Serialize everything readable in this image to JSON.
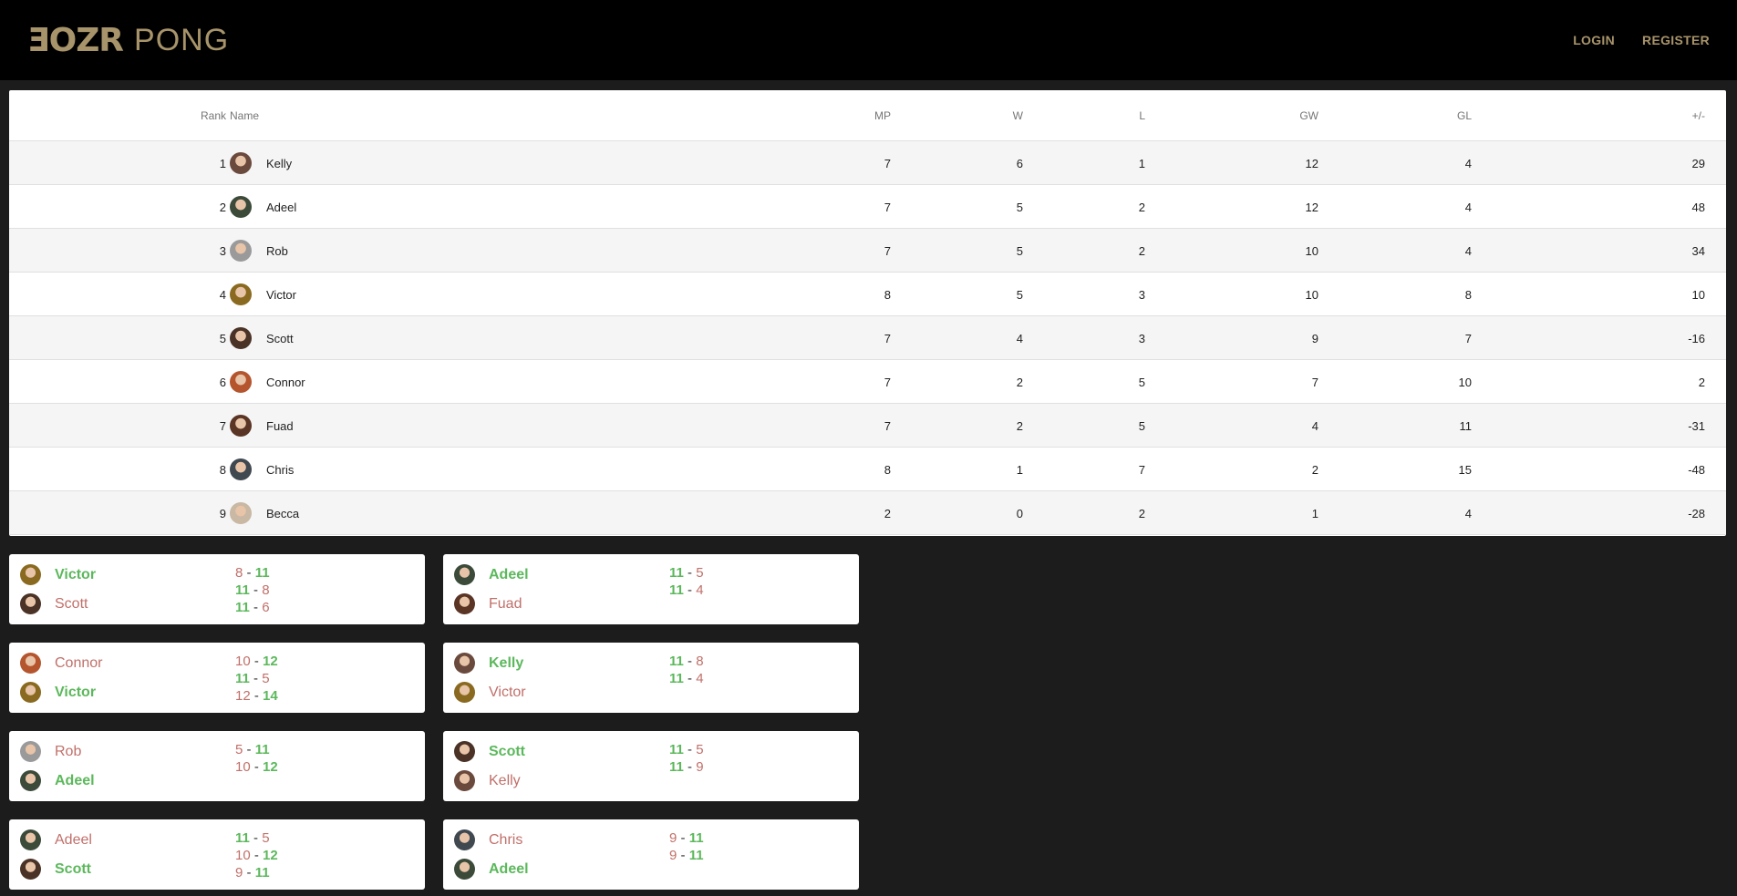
{
  "brand": {
    "mark": "ƎOZR",
    "word": "PONG",
    "color": "#a8946a"
  },
  "nav": {
    "login": "LOGIN",
    "register": "REGISTER"
  },
  "table": {
    "headers": {
      "rank": "Rank",
      "name": "Name",
      "mp": "MP",
      "w": "W",
      "l": "L",
      "gw": "GW",
      "gl": "GL",
      "pm": "+/-"
    },
    "rows": [
      {
        "rank": "1",
        "name": "Kelly",
        "mp": "7",
        "w": "6",
        "l": "1",
        "gw": "12",
        "gl": "4",
        "pm": "29"
      },
      {
        "rank": "2",
        "name": "Adeel",
        "mp": "7",
        "w": "5",
        "l": "2",
        "gw": "12",
        "gl": "4",
        "pm": "48"
      },
      {
        "rank": "3",
        "name": "Rob",
        "mp": "7",
        "w": "5",
        "l": "2",
        "gw": "10",
        "gl": "4",
        "pm": "34"
      },
      {
        "rank": "4",
        "name": "Victor",
        "mp": "8",
        "w": "5",
        "l": "3",
        "gw": "10",
        "gl": "8",
        "pm": "10"
      },
      {
        "rank": "5",
        "name": "Scott",
        "mp": "7",
        "w": "4",
        "l": "3",
        "gw": "9",
        "gl": "7",
        "pm": "-16"
      },
      {
        "rank": "6",
        "name": "Connor",
        "mp": "7",
        "w": "2",
        "l": "5",
        "gw": "7",
        "gl": "10",
        "pm": "2"
      },
      {
        "rank": "7",
        "name": "Fuad",
        "mp": "7",
        "w": "2",
        "l": "5",
        "gw": "4",
        "gl": "11",
        "pm": "-31"
      },
      {
        "rank": "8",
        "name": "Chris",
        "mp": "8",
        "w": "1",
        "l": "7",
        "gw": "2",
        "gl": "15",
        "pm": "-48"
      },
      {
        "rank": "9",
        "name": "Becca",
        "mp": "2",
        "w": "0",
        "l": "2",
        "gw": "1",
        "gl": "4",
        "pm": "-28"
      }
    ]
  },
  "matches": [
    {
      "p1": {
        "name": "Victor",
        "win": true
      },
      "p2": {
        "name": "Scott",
        "win": false
      },
      "sets": [
        {
          "a": "8",
          "b": "11",
          "aw": false
        },
        {
          "a": "11",
          "b": "8",
          "aw": true
        },
        {
          "a": "11",
          "b": "6",
          "aw": true
        }
      ]
    },
    {
      "p1": {
        "name": "Adeel",
        "win": true
      },
      "p2": {
        "name": "Fuad",
        "win": false
      },
      "sets": [
        {
          "a": "11",
          "b": "5",
          "aw": true
        },
        {
          "a": "11",
          "b": "4",
          "aw": true
        }
      ]
    },
    {
      "p1": {
        "name": "Connor",
        "win": false
      },
      "p2": {
        "name": "Victor",
        "win": true
      },
      "sets": [
        {
          "a": "10",
          "b": "12",
          "aw": false
        },
        {
          "a": "11",
          "b": "5",
          "aw": true
        },
        {
          "a": "12",
          "b": "14",
          "aw": false
        }
      ]
    },
    {
      "p1": {
        "name": "Kelly",
        "win": true
      },
      "p2": {
        "name": "Victor",
        "win": false
      },
      "sets": [
        {
          "a": "11",
          "b": "8",
          "aw": true
        },
        {
          "a": "11",
          "b": "4",
          "aw": true
        }
      ]
    },
    {
      "p1": {
        "name": "Rob",
        "win": false
      },
      "p2": {
        "name": "Adeel",
        "win": true
      },
      "sets": [
        {
          "a": "5",
          "b": "11",
          "aw": false
        },
        {
          "a": "10",
          "b": "12",
          "aw": false
        }
      ]
    },
    {
      "p1": {
        "name": "Scott",
        "win": true
      },
      "p2": {
        "name": "Kelly",
        "win": false
      },
      "sets": [
        {
          "a": "11",
          "b": "5",
          "aw": true
        },
        {
          "a": "11",
          "b": "9",
          "aw": true
        }
      ]
    },
    {
      "p1": {
        "name": "Adeel",
        "win": false
      },
      "p2": {
        "name": "Scott",
        "win": true
      },
      "sets": [
        {
          "a": "11",
          "b": "5",
          "aw": true
        },
        {
          "a": "10",
          "b": "12",
          "aw": false
        },
        {
          "a": "9",
          "b": "11",
          "aw": false
        }
      ]
    },
    {
      "p1": {
        "name": "Chris",
        "win": false
      },
      "p2": {
        "name": "Adeel",
        "win": true
      },
      "sets": [
        {
          "a": "9",
          "b": "11",
          "aw": false
        },
        {
          "a": "9",
          "b": "11",
          "aw": false
        }
      ]
    }
  ],
  "avatar_colors": {
    "Kelly": "#6b4a3e",
    "Adeel": "#3c4a3a",
    "Rob": "#9a9a9a",
    "Victor": "#8a6a20",
    "Scott": "#4a3226",
    "Connor": "#b4552e",
    "Fuad": "#5a3424",
    "Chris": "#404850",
    "Becca": "#c8b8a4"
  },
  "colors": {
    "win": "#5cb85c",
    "lose": "#c0706a"
  }
}
